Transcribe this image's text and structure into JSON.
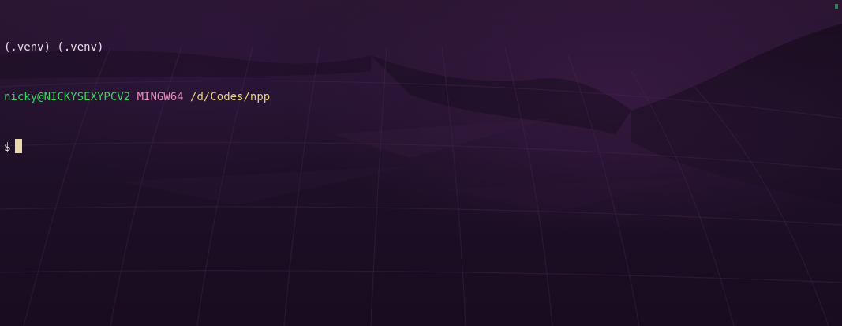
{
  "terminal": {
    "lines": {
      "venv": "(.venv) (.venv)",
      "user_host": "nicky@NICKYSEXYPCV2",
      "system": "MINGW64",
      "path": "/d/Codes/npp",
      "prompt_symbol": "$"
    },
    "colors": {
      "background": "#1c0f24",
      "text": "#e6dfe8",
      "user_host": "#3cd35f",
      "system": "#e78fbf",
      "path": "#e8d27a",
      "cursor": "#ead7ad"
    }
  }
}
